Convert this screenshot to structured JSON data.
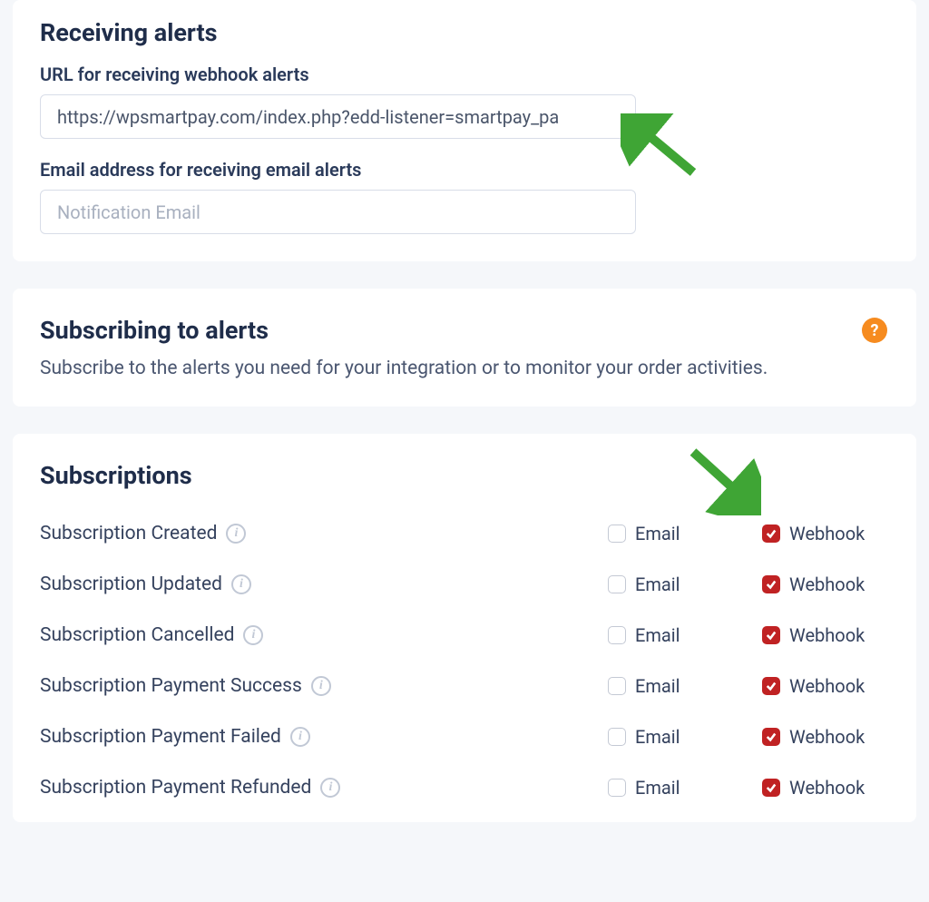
{
  "receiving": {
    "heading": "Receiving alerts",
    "url_label": "URL for receiving webhook alerts",
    "url_value": "https://wpsmartpay.com/index.php?edd-listener=smartpay_pa",
    "email_label": "Email address for receiving email alerts",
    "email_placeholder": "Notification Email"
  },
  "subscribing": {
    "heading": "Subscribing to alerts",
    "description": "Subscribe to the alerts you need for your integration or to monitor your order activities.",
    "help_symbol": "?"
  },
  "subscriptions": {
    "heading": "Subscriptions",
    "email_label": "Email",
    "webhook_label": "Webhook",
    "rows": [
      {
        "name": "Subscription Created",
        "email": false,
        "webhook": true
      },
      {
        "name": "Subscription Updated",
        "email": false,
        "webhook": true
      },
      {
        "name": "Subscription Cancelled",
        "email": false,
        "webhook": true
      },
      {
        "name": "Subscription Payment Success",
        "email": false,
        "webhook": true
      },
      {
        "name": "Subscription Payment Failed",
        "email": false,
        "webhook": true
      },
      {
        "name": "Subscription Payment Refunded",
        "email": false,
        "webhook": true
      }
    ]
  },
  "annotations": {
    "arrow_color": "#3fa535"
  }
}
